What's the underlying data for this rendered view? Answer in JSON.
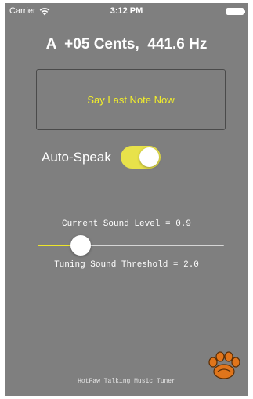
{
  "status_bar": {
    "carrier": "Carrier",
    "time": "3:12 PM",
    "icons": [
      "wifi-icon",
      "battery-icon"
    ]
  },
  "tuner": {
    "readout": "A  +05 Cents,  441.6 Hz"
  },
  "say_note_button": {
    "label": "Say Last Note Now"
  },
  "auto_speak": {
    "label": "Auto-Speak",
    "on": true
  },
  "sound": {
    "current_level_text": "Current Sound Level = 0.9",
    "threshold_text": "Tuning Sound Threshold = 2.0",
    "threshold_slider_fraction": 0.23
  },
  "footer": {
    "app_name": "HotPaw Talking Music Tuner"
  },
  "colors": {
    "background": "#7f7f7f",
    "accent_yellow": "#e8e24a",
    "button_text": "#f3ef2a",
    "logo_orange": "#e0751b"
  }
}
